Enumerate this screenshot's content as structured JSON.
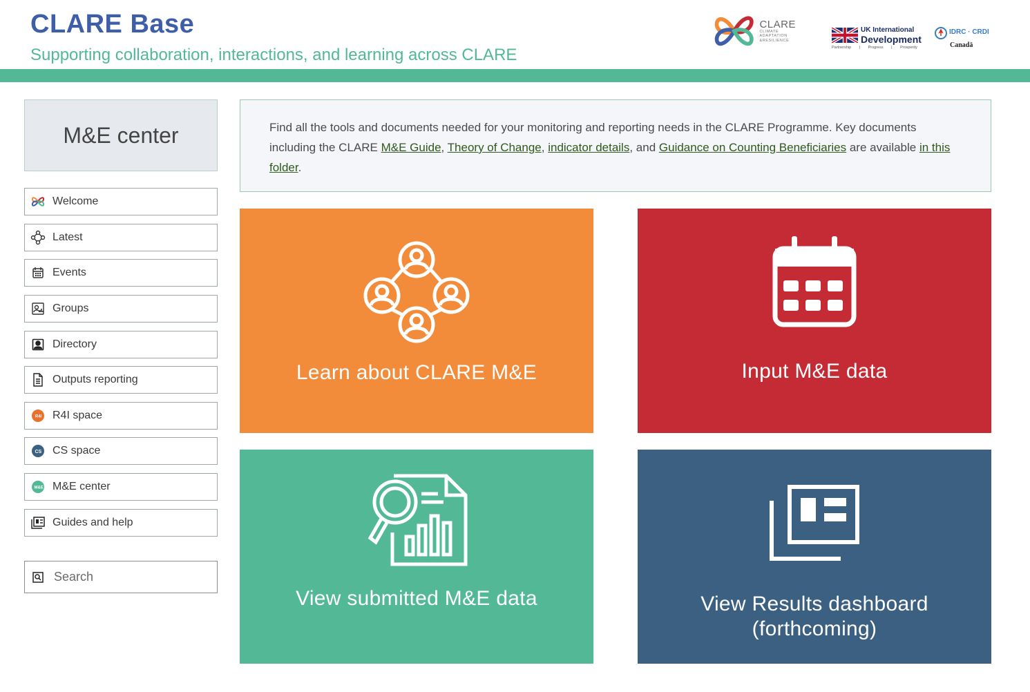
{
  "header": {
    "title": "CLARE Base",
    "subtitle": "Supporting collaboration, interactions, and learning across CLARE"
  },
  "logos": {
    "clare": {
      "name": "CLARE",
      "tagline_1": "CLIMATE",
      "tagline_2": "ADAPTATION",
      "tagline_3": "&RESILIENCE"
    },
    "ukid": {
      "line1": "UK International",
      "line2": "Development",
      "line3": "Partnership | Progress | Prosperity"
    },
    "idrc": {
      "line1": "IDRC · CRDI",
      "line2": "Canadä"
    }
  },
  "sidebar": {
    "header": "M&E center",
    "items": [
      {
        "label": "Welcome",
        "icon": "clare-logo-icon"
      },
      {
        "label": "Latest",
        "icon": "network-icon"
      },
      {
        "label": "Events",
        "icon": "calendar-icon"
      },
      {
        "label": "Groups",
        "icon": "groups-icon"
      },
      {
        "label": "Directory",
        "icon": "person-icon"
      },
      {
        "label": "Outputs reporting",
        "icon": "document-icon"
      },
      {
        "label": "R4I space",
        "icon": "r4i-icon"
      },
      {
        "label": "CS space",
        "icon": "cs-icon"
      },
      {
        "label": "M&E center",
        "icon": "me-icon"
      },
      {
        "label": "Guides and help",
        "icon": "guides-icon"
      }
    ],
    "search_label": "Search"
  },
  "info": {
    "text_1": "Find all the tools and documents needed for your monitoring and reporting needs in the CLARE Programme. Key documents including the CLARE ",
    "link_me_guide": "M&E Guide",
    "sep_1": ", ",
    "link_toc": "Theory of Change",
    "sep_2": ", ",
    "link_indicators": "indicator details",
    "sep_3": ", and ",
    "link_guidance": "Guidance on Counting Beneficiaries",
    "text_2": " are available ",
    "link_folder": "in this folder",
    "text_3": "."
  },
  "tiles": {
    "learn": {
      "label": "Learn about CLARE M&E",
      "color": "#f28c3b"
    },
    "input": {
      "label": "Input M&E data",
      "color": "#c42b34"
    },
    "view": {
      "label": "View submitted M&E data",
      "color": "#52b896"
    },
    "results": {
      "label_1": "View Results dashboard",
      "label_2": "(forthcoming)",
      "color": "#3c6082"
    }
  }
}
